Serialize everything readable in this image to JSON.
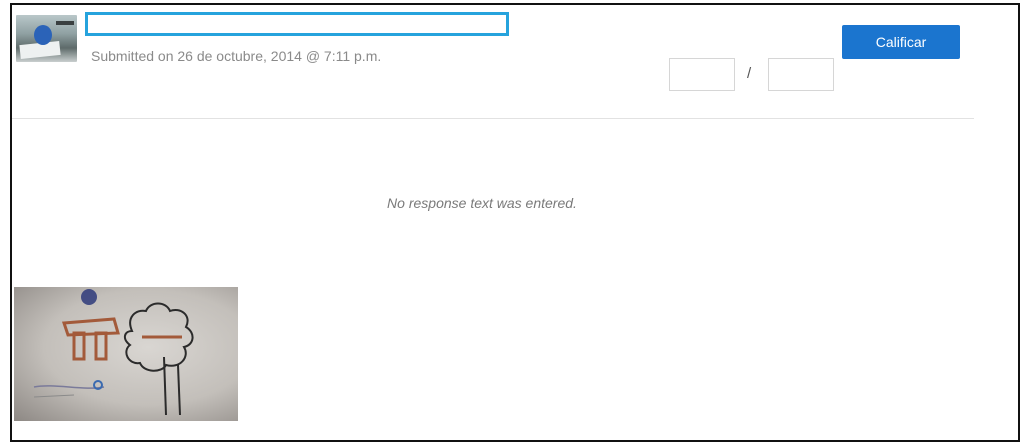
{
  "submission": {
    "submitted_text": "Submitted on 26 de octubre, 2014 @ 7:11 p.m.",
    "no_response_text": "No response text was entered."
  },
  "grading": {
    "button_label": "Calificar",
    "separator": "/",
    "score_value": "",
    "max_value": ""
  },
  "colors": {
    "primary_button": "#1b75cf",
    "highlight_border": "#26a3dd"
  }
}
